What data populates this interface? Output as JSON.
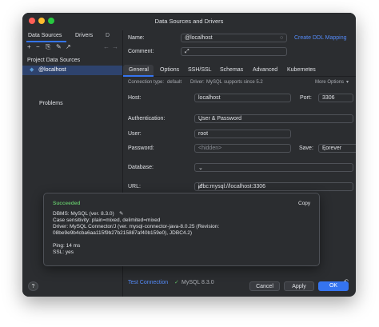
{
  "window": {
    "title": "Data Sources and Drivers"
  },
  "left": {
    "tabs": [
      "Data Sources",
      "Drivers",
      "D"
    ],
    "section_title": "Project Data Sources",
    "selected_item": "@localhost",
    "problems_label": "Problems"
  },
  "form": {
    "name_label": "Name:",
    "name_value": "@localhost",
    "create_ddl_label": "Create DDL Mapping",
    "comment_label": "Comment:",
    "tabs": [
      "General",
      "Options",
      "SSH/SSL",
      "Schemas",
      "Advanced",
      "Kubernetes"
    ],
    "connection_type_label": "Connection type:",
    "connection_type_value": "default",
    "driver_label": "Driver:",
    "driver_value": "MySQL",
    "driver_note": "supports since 5.2",
    "more_options": "More Options",
    "host_label": "Host:",
    "host_value": "localhost",
    "port_label": "Port:",
    "port_value": "3306",
    "auth_label": "Authentication:",
    "auth_value": "User & Password",
    "user_label": "User:",
    "user_value": "root",
    "password_label": "Password:",
    "password_value": "<hidden>",
    "save_label": "Save:",
    "save_value": "Forever",
    "database_label": "Database:",
    "url_label": "URL:",
    "url_value": "jdbc:mysql://localhost:3306"
  },
  "popup": {
    "status": "Succeeded",
    "copy_label": "Copy",
    "lines": [
      "DBMS: MySQL (ver. 8.3.0)",
      "Case sensitivity: plain=mixed, delimited=mixed",
      "Driver: MySQL Connector/J (ver. mysql-connector-java-8.0.25 (Revision:",
      "08be9e9b4cba6aa115f9b27b215887af40b159e0), JDBC4.2)",
      "",
      "Ping: 14 ms",
      "SSL: yes"
    ]
  },
  "footer": {
    "test_connection": "Test Connection",
    "test_result": "MySQL 8.3.0",
    "cancel": "Cancel",
    "apply": "Apply",
    "ok": "OK",
    "help": "?"
  },
  "colors": {
    "accent": "#3574f0",
    "success": "#5fb865",
    "link": "#548af7",
    "traffic_red": "#ff5f57",
    "traffic_yellow": "#febc2e",
    "traffic_green": "#28c840"
  }
}
